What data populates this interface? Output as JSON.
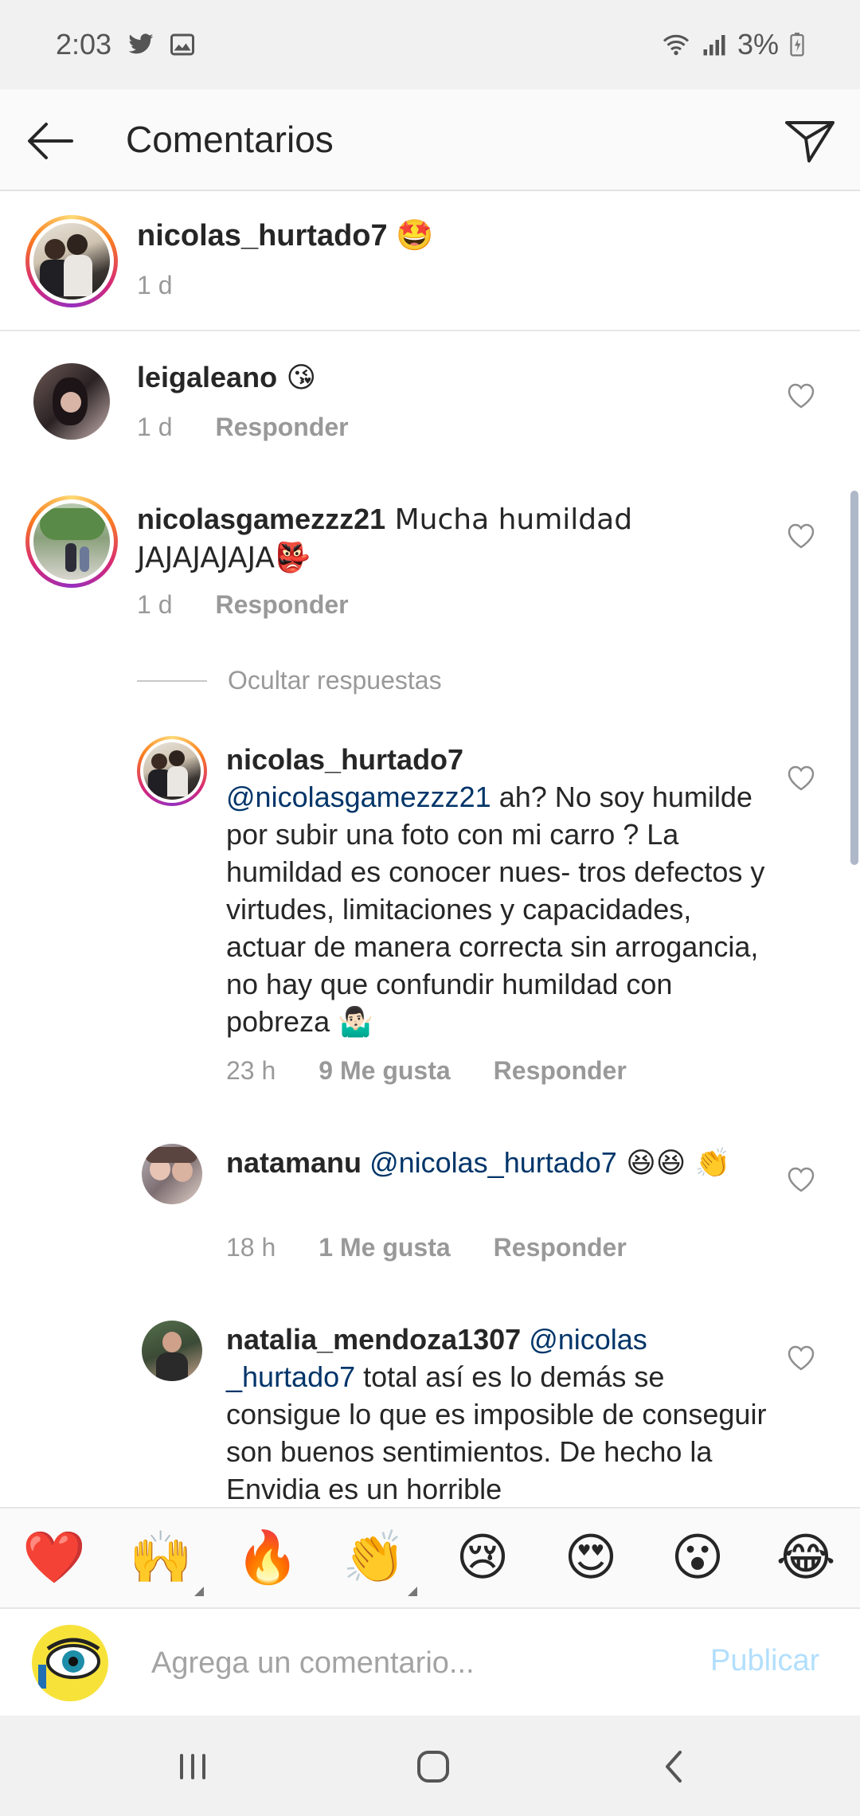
{
  "status_bar": {
    "time": "2:03",
    "battery": "3%"
  },
  "header": {
    "title": "Comentarios"
  },
  "caption": {
    "username": "nicolas_hurtado7",
    "emoji": "🤩",
    "time": "1 d"
  },
  "comments": [
    {
      "username": "leigaleano",
      "text": " 😘",
      "time": "1 d",
      "reply_label": "Responder"
    },
    {
      "username": "nicolasgamezzz21",
      "text": " Mucha humildad JAJAJAJAJA👺",
      "time": "1 d",
      "reply_label": "Responder"
    }
  ],
  "hide_replies_label": "Ocultar respuestas",
  "replies": [
    {
      "username": "nicolas_hurtado7",
      "mention": "@nicolasgamezzz21",
      "text": " ah? No soy humilde por subir una foto con mi carro ? La humildad es conocer nues- tros defectos y virtudes, limitaciones y capacidades, actuar de manera correcta sin  arrogancia, no hay que confundir humildad con pobreza 🤷🏻‍♂️",
      "time": "23 h",
      "likes": "9 Me gusta",
      "reply_label": "Responder"
    },
    {
      "username": "natamanu",
      "mention": "@nicolas_hurtado7",
      "text": " 😆😆 👏",
      "time": "18 h",
      "likes": "1 Me gusta",
      "reply_label": "Responder"
    },
    {
      "username": "natalia_mendoza1307",
      "mention": "@nicolas _hurtado7",
      "text": " total así es lo demás se consigue lo que es imposible de conseguir son buenos sentimientos. De hecho la Envidia es un horrible"
    }
  ],
  "emoji_bar": [
    "❤️",
    "🙌",
    "🔥",
    "👏",
    "😢",
    "😍",
    "😮",
    "😂"
  ],
  "input": {
    "placeholder": "Agrega un comentario...",
    "publish_label": "Publicar"
  },
  "colors": {
    "mention": "#003569",
    "publish_disabled": "#b2dffc",
    "meta_text": "#999999"
  }
}
